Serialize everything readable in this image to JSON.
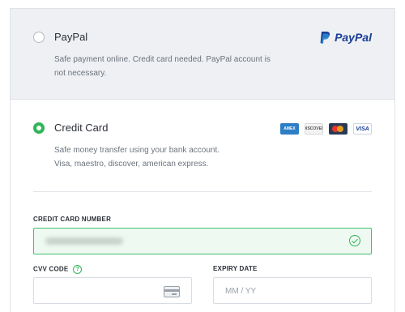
{
  "paypal": {
    "title": "PayPal",
    "description_line1": "Safe payment online. Credit card needed. PayPal account is",
    "description_line2": "not necessary.",
    "logo_text": "PayPal",
    "selected": false
  },
  "credit_card": {
    "title": "Credit Card",
    "description_line1": "Safe money transfer using your bank account.",
    "description_line2": "Visa, maestro, discover, american express.",
    "selected": true,
    "card_logos": [
      "AMEX",
      "DISCOVER",
      "",
      "VISA"
    ]
  },
  "form": {
    "card_number_label": "CREDIT CARD NUMBER",
    "cvv_label": "CVV CODE",
    "help_icon": "?",
    "expiry_label": "EXPIRY DATE",
    "expiry_placeholder": "MM / YY"
  },
  "colors": {
    "accent_green": "#2fb657",
    "paypal_blue": "#1a3e96",
    "panel_gray": "#eef0f3"
  }
}
